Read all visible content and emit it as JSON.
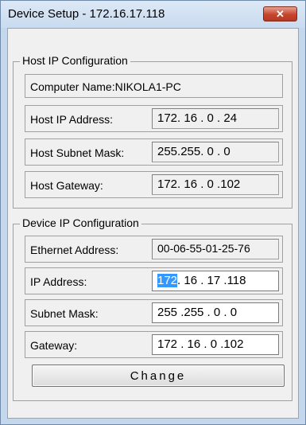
{
  "window": {
    "title": "Device Setup - 172.16.17.118",
    "close_label": "✕"
  },
  "host_group": {
    "title": "Host IP Configuration",
    "computer_name": "Computer Name:NIKOLA1-PC",
    "ip_label": "Host IP Address:",
    "ip_value": "172. 16 . 0 . 24",
    "mask_label": "Host Subnet Mask:",
    "mask_value": "255.255. 0 . 0",
    "gateway_label": "Host Gateway:",
    "gateway_value": "172. 16 . 0 .102"
  },
  "device_group": {
    "title": "Device IP Configuration",
    "ethernet_label": "Ethernet Address:",
    "ethernet_value": "00-06-55-01-25-76",
    "ip_label": "IP Address:",
    "ip_selected": "172",
    "ip_rest": ". 16 . 17 .118",
    "mask_label": "Subnet Mask:",
    "mask_value": "255 .255 . 0 . 0",
    "gateway_label": "Gateway:",
    "gateway_value": "172 . 16 . 0 .102"
  },
  "buttons": {
    "change_label": "Change"
  }
}
